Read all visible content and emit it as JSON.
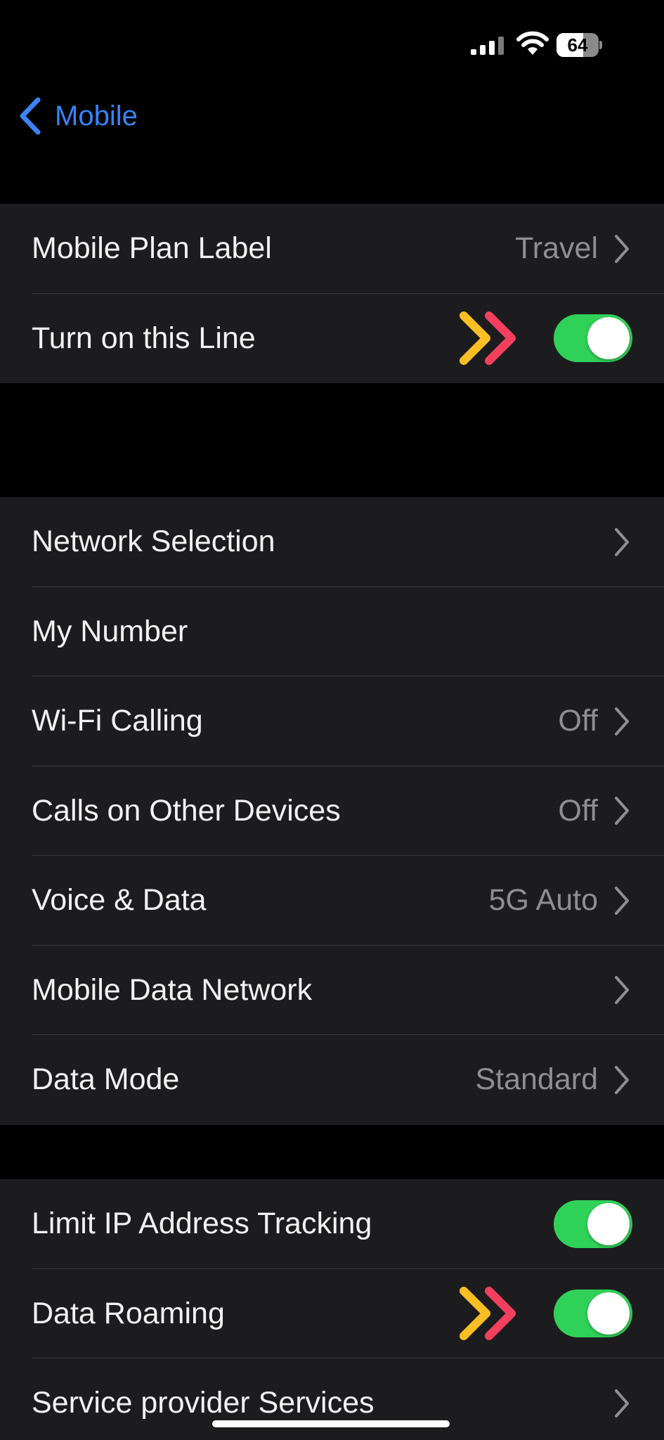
{
  "status_bar": {
    "battery_level": "64",
    "battery_fraction": 0.64,
    "signal_icon": "cellular-signal-icon",
    "wifi_icon": "wifi-icon"
  },
  "nav": {
    "back_label": "Mobile",
    "back_icon": "chevron-left-icon",
    "accent_color": "#3b82f6"
  },
  "group1": [
    {
      "label": "Mobile Plan Label",
      "value": "Travel",
      "chevron": true
    },
    {
      "label": "Turn on this Line",
      "toggle": true,
      "on": true,
      "annotation": "double-chevron-arrows"
    }
  ],
  "group2": [
    {
      "label": "Network Selection",
      "value": "",
      "chevron": true
    },
    {
      "label": "My Number",
      "value": "",
      "chevron": false
    },
    {
      "label": "Wi-Fi Calling",
      "value": "Off",
      "chevron": true
    },
    {
      "label": "Calls on Other Devices",
      "value": "Off",
      "chevron": true
    },
    {
      "label": "Voice & Data",
      "value": "5G Auto",
      "chevron": true
    },
    {
      "label": "Mobile Data Network",
      "value": "",
      "chevron": true
    },
    {
      "label": "Data Mode",
      "value": "Standard",
      "chevron": true
    }
  ],
  "group3": [
    {
      "label": "Limit IP Address Tracking",
      "toggle": true,
      "on": true
    },
    {
      "label": "Data Roaming",
      "toggle": true,
      "on": true,
      "annotation": "double-chevron-arrows"
    },
    {
      "label": "Service provider Services",
      "value": "",
      "chevron": true
    }
  ],
  "colors": {
    "toggle_on": "#30d158",
    "arrow_yellow": "#fbbf24",
    "arrow_red": "#f43f5e"
  }
}
